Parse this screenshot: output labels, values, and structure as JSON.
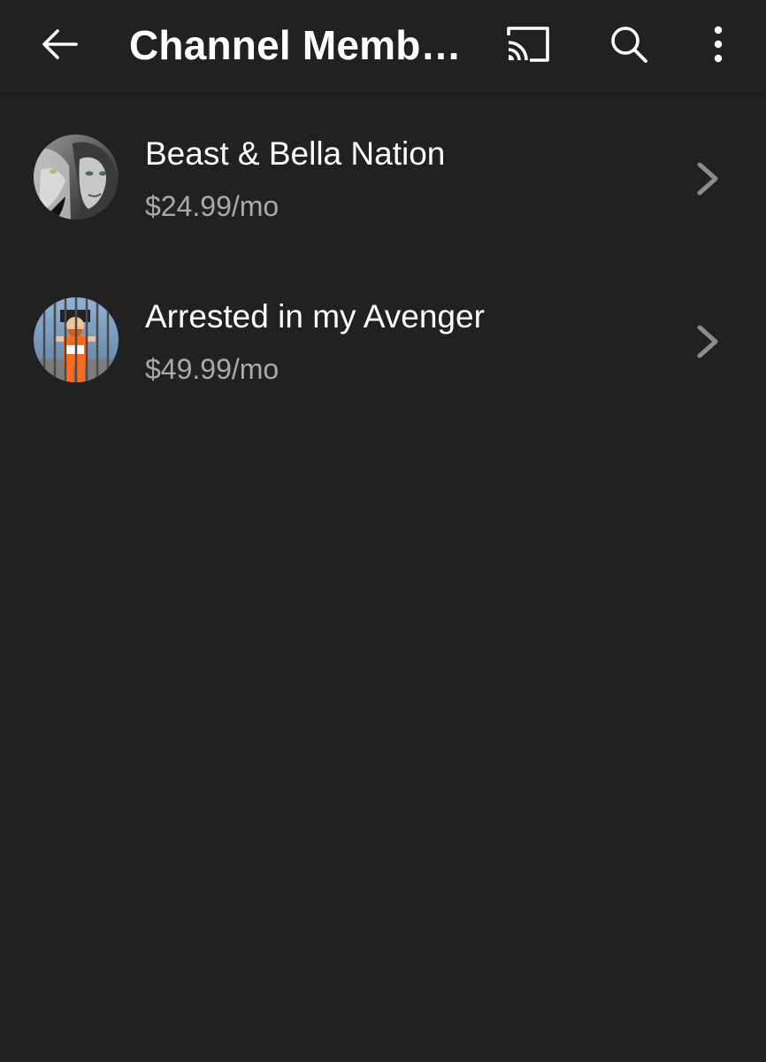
{
  "header": {
    "title": "Channel Membe…",
    "back_icon": "arrow-left-icon",
    "cast_icon": "cast-icon",
    "search_icon": "search-icon",
    "more_icon": "more-vertical-icon"
  },
  "memberships": [
    {
      "name": "Beast & Bella Nation",
      "price": "$24.99/mo",
      "avatar_icon": "wolf-woman-avatar"
    },
    {
      "name": "Arrested in my Avenger",
      "price": "$49.99/mo",
      "avatar_icon": "prisoner-avatar"
    }
  ],
  "colors": {
    "background": "#212121",
    "primary_text": "#ffffff",
    "secondary_text": "#aaaaaa",
    "chevron": "#8c8c8c"
  }
}
